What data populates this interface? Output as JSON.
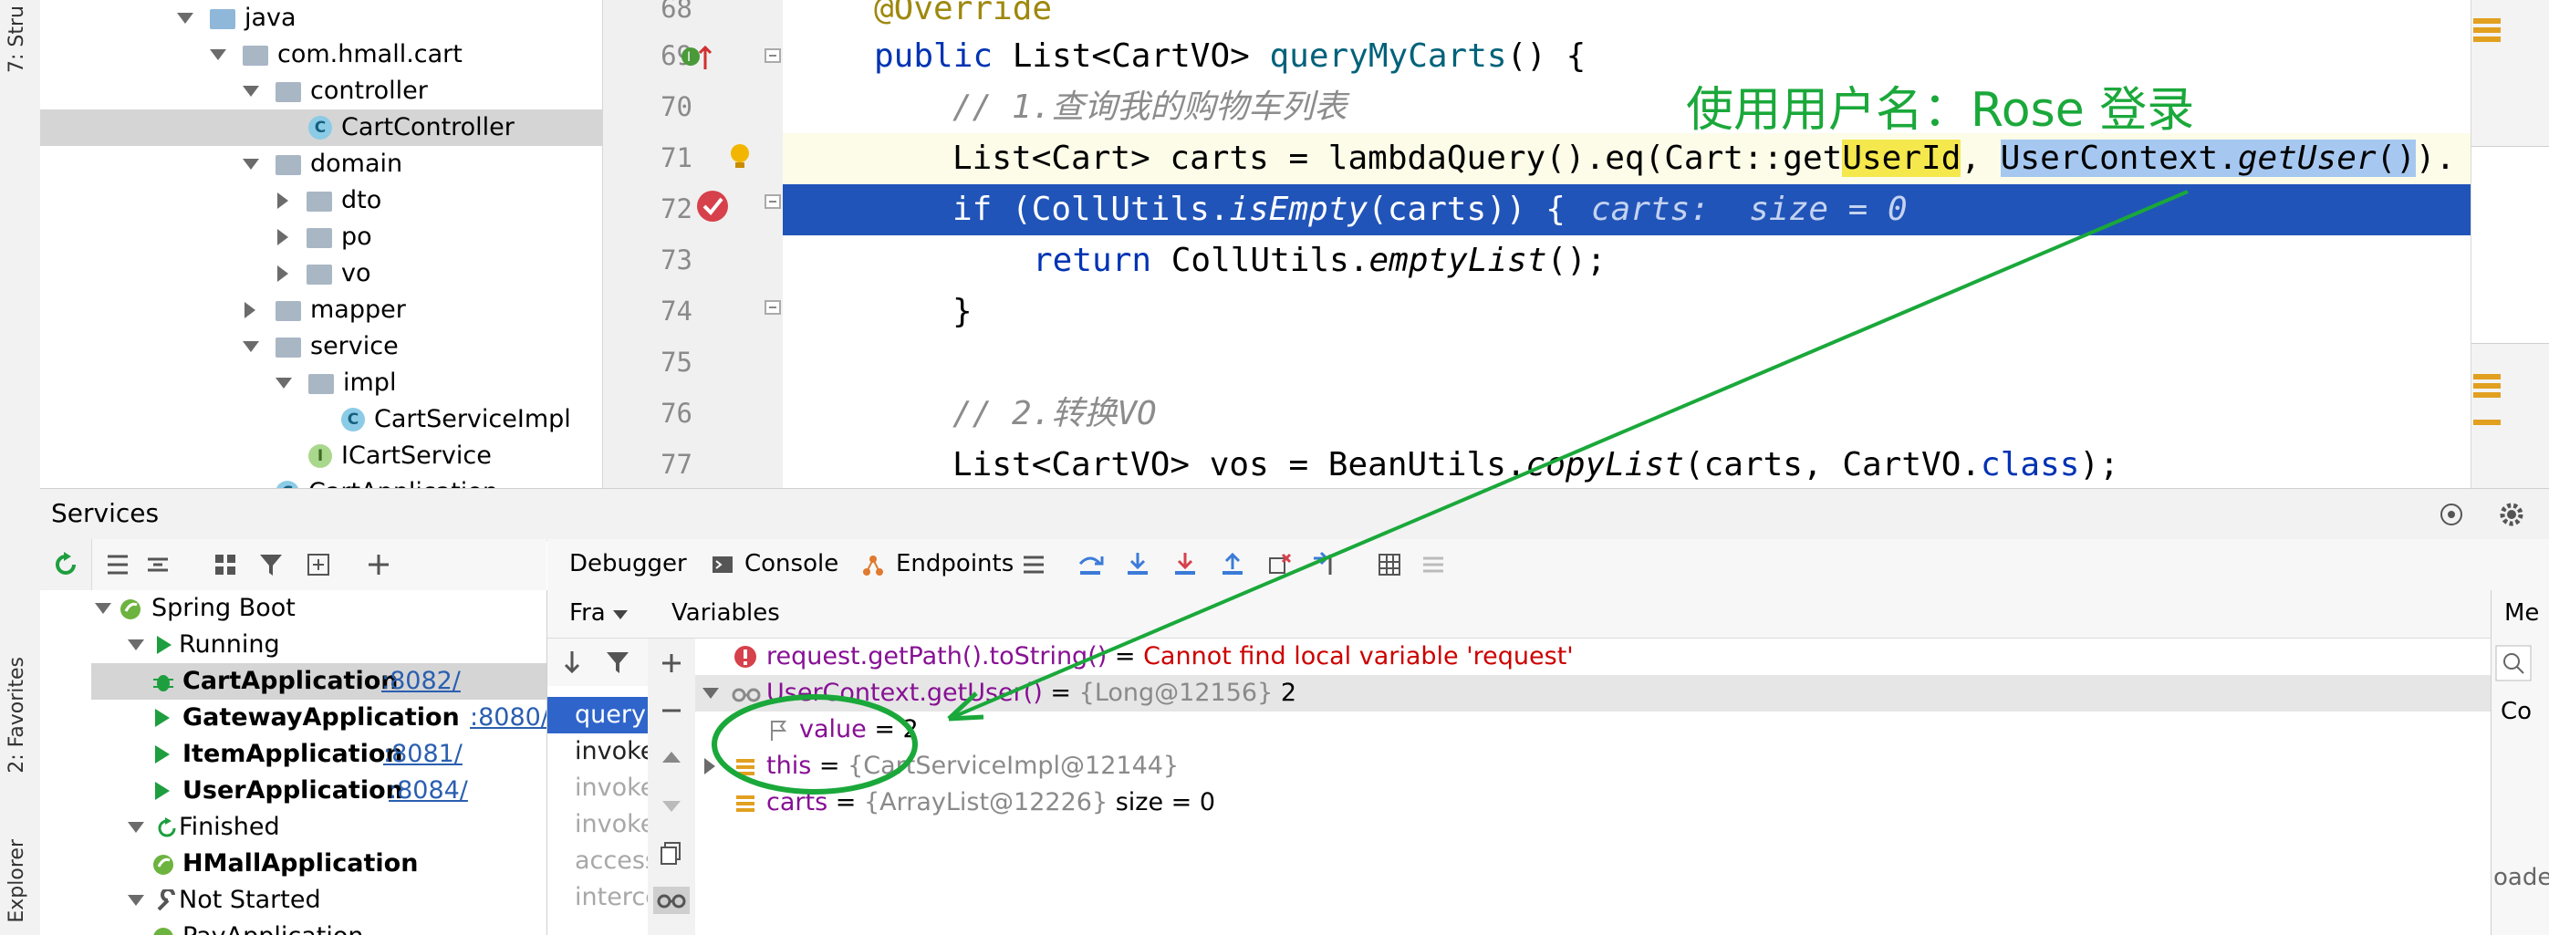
{
  "left_strip": {
    "labels": [
      "7: Stru",
      "2: Favorites",
      "Explorer"
    ]
  },
  "project_tree": {
    "rows": [
      {
        "label": "java",
        "kind": "folder-blue",
        "expanded": true
      },
      {
        "label": "com.hmall.cart",
        "kind": "folder",
        "expanded": true
      },
      {
        "label": "controller",
        "kind": "folder",
        "expanded": true
      },
      {
        "label": "CartController",
        "kind": "class",
        "selected": true
      },
      {
        "label": "domain",
        "kind": "folder",
        "expanded": true
      },
      {
        "label": "dto",
        "kind": "folder",
        "expanded": false
      },
      {
        "label": "po",
        "kind": "folder",
        "expanded": false
      },
      {
        "label": "vo",
        "kind": "folder",
        "expanded": false
      },
      {
        "label": "mapper",
        "kind": "folder",
        "expanded": false
      },
      {
        "label": "service",
        "kind": "folder",
        "expanded": true
      },
      {
        "label": "impl",
        "kind": "folder",
        "expanded": true
      },
      {
        "label": "CartServiceImpl",
        "kind": "class"
      },
      {
        "label": "ICartService",
        "kind": "interface"
      },
      {
        "label": "CartApplication",
        "kind": "class"
      }
    ]
  },
  "editor": {
    "line_numbers": [
      "68",
      "69",
      "70",
      "71",
      "72",
      "73",
      "74",
      "75",
      "76",
      "77"
    ],
    "lines": {
      "l68": "@Override",
      "l69_kw": "public",
      "l69_type": " List<CartVO> ",
      "l69_fn": "queryMyCarts",
      "l69_rest": "() {",
      "l70": "// 1.查询我的购物车列表",
      "l71_a": "List<Cart> carts = lambdaQuery().eq(Cart::get",
      "l71_hl": "UserId",
      "l71_b": ", ",
      "l71_sel1": "UserContext.",
      "l71_sel2": "getUser",
      "l71_sel3": "()",
      "l71_c": ").",
      "l72_kw": "if",
      "l72_a": " (CollUtils.",
      "l72_fn": "isEmpty",
      "l72_b": "(carts)) {",
      "l72_inlay": "carts:  size = 0",
      "l73_kw": "return",
      "l73_a": " CollUtils.",
      "l73_fn": "emptyList",
      "l73_b": "();",
      "l74": "}",
      "l75": "",
      "l76": "// 2.转换VO",
      "l77_a": "List<CartVO> vos = BeanUtils.",
      "l77_fn": "copyList",
      "l77_b": "(carts, CartVO.",
      "l77_kw": "class",
      "l77_c": ");"
    },
    "annotation": "使用用户名：Rose  登录"
  },
  "services": {
    "title": "Services",
    "tree": [
      {
        "label": "Spring Boot",
        "level": 0
      },
      {
        "label": "Running",
        "level": 1
      },
      {
        "label": "CartApplication",
        "port": ":8082/",
        "level": 2,
        "selected": true
      },
      {
        "label": "GatewayApplication",
        "port": ":8080/",
        "level": 2
      },
      {
        "label": "ItemApplication",
        "port": ":8081/",
        "level": 2
      },
      {
        "label": "UserApplication",
        "port": ":8084/",
        "level": 2
      },
      {
        "label": "Finished",
        "level": 1
      },
      {
        "label": "HMallApplication",
        "level": 2
      },
      {
        "label": "Not Started",
        "level": 1
      },
      {
        "label": "PayApplication",
        "level": 2
      }
    ]
  },
  "debugger": {
    "tabs": [
      "Debugger",
      "Console",
      "Endpoints"
    ],
    "frames_header": "Fra",
    "variables_header": "Variables",
    "memory_header": "Me",
    "frames": [
      "queryM",
      "invoke",
      "invoke",
      "invoke",
      "access",
      "interce"
    ],
    "variables": [
      {
        "name": "request.getPath().toString()",
        "eq": " = ",
        "value": "Cannot find local variable 'request'",
        "kind": "error"
      },
      {
        "name": "UserContext.getUser()",
        "eq": " = ",
        "type": "{Long@12156}",
        "value": " 2",
        "kind": "watch",
        "expanded": true
      },
      {
        "name": "value",
        "eq": " = ",
        "value": "2",
        "kind": "field"
      },
      {
        "name": "this",
        "eq": " = ",
        "type": "{CartServiceImpl@12144}",
        "value": "",
        "kind": "object"
      },
      {
        "name": "carts",
        "eq": " = ",
        "type": "{ArrayList@12226}",
        "value": "  size = 0",
        "kind": "list"
      }
    ],
    "right_stub": "Co",
    "right_stub2": "oade"
  },
  "colors": {
    "annotation_green": "#1aa83a",
    "selection_blue": "#2154b8",
    "keyword_blue": "#0033b3"
  }
}
